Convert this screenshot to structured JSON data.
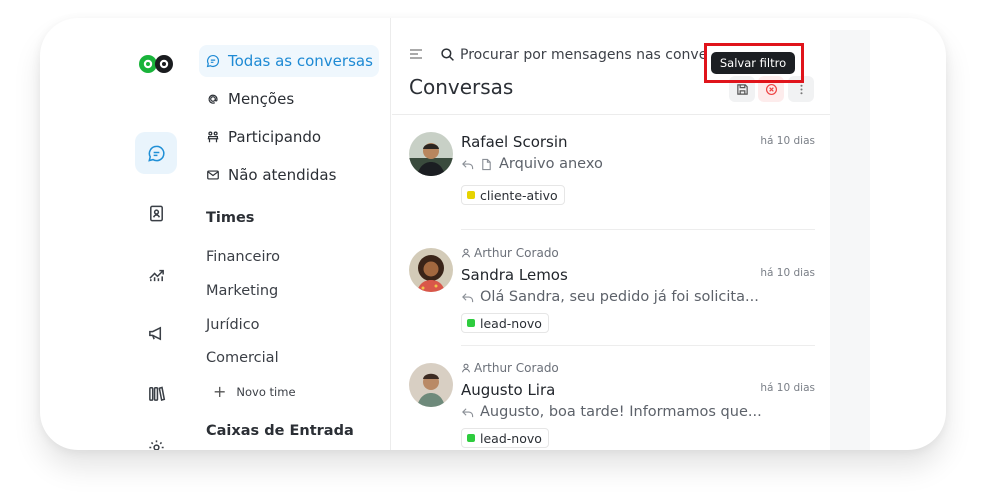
{
  "sidebar": {
    "nav": [
      {
        "label": "Todas as conversas"
      },
      {
        "label": "Menções"
      },
      {
        "label": "Participando"
      },
      {
        "label": "Não atendidas"
      }
    ],
    "teams_title": "Times",
    "teams": [
      "Financeiro",
      "Marketing",
      "Jurídico",
      "Comercial"
    ],
    "new_team_label": "Novo time",
    "inboxes_title": "Caixas de Entrada"
  },
  "main": {
    "search_placeholder": "Procurar por mensagens nas conve",
    "title": "Conversas",
    "tooltip": "Salvar filtro",
    "conversations": [
      {
        "assignee": "",
        "name": "Rafael Scorsin",
        "time": "há 10 dias",
        "message": "Arquivo anexo",
        "label": "cliente-ativo",
        "label_color": "#e6d300"
      },
      {
        "assignee": "Arthur Corado",
        "name": "Sandra Lemos",
        "time": "há 10 dias",
        "message": "Olá Sandra, seu pedido já foi solicita...",
        "label": "lead-novo",
        "label_color": "#2ecc3e"
      },
      {
        "assignee": "Arthur Corado",
        "name": "Augusto Lira",
        "time": "há 10 dias",
        "message": "Augusto, boa tarde! Informamos que...",
        "label": "lead-novo",
        "label_color": "#2ecc3e"
      }
    ]
  },
  "colors": {
    "accent": "#1e8ad4",
    "brand_green": "#19b33a",
    "highlight": "#e0141b"
  }
}
